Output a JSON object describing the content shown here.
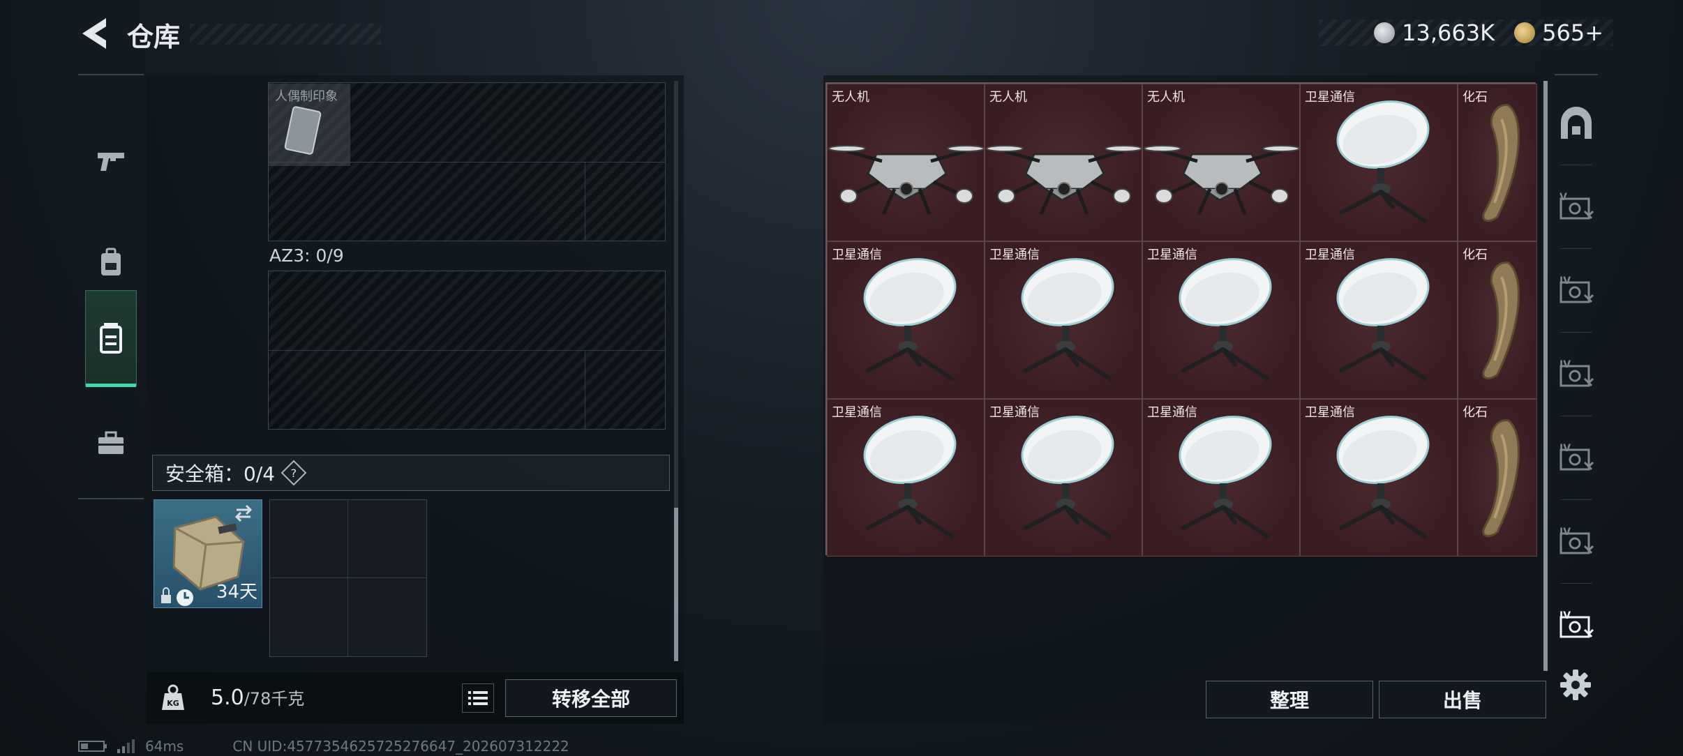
{
  "header": {
    "title": "仓库",
    "currency_silver": "13,663K",
    "currency_gold": "565+"
  },
  "left_nav": {
    "items": [
      "pistol-icon",
      "backpack-icon",
      "chest-rig-icon",
      "toolbox-icon"
    ],
    "active_index": 2
  },
  "left_panel": {
    "tagged_bag_label": "人偶制印象",
    "container_label": "AZ3: 0/9",
    "safe_box_label": "安全箱：0/4",
    "safe_help": "?",
    "safe_item_days": "34天",
    "weight_value": "5.0",
    "weight_max": "/78千克",
    "transfer_all": "转移全部"
  },
  "items": [
    {
      "label": "无人机",
      "icon": "drone-icon"
    },
    {
      "label": "无人机",
      "icon": "drone-icon"
    },
    {
      "label": "无人机",
      "icon": "drone-icon"
    },
    {
      "label": "卫星通信",
      "icon": "satellite-dish-icon"
    },
    {
      "label": "化石",
      "icon": "fossil-claw-icon"
    },
    {
      "label": "卫星通信",
      "icon": "satellite-dish-icon"
    },
    {
      "label": "卫星通信",
      "icon": "satellite-dish-icon"
    },
    {
      "label": "卫星通信",
      "icon": "satellite-dish-icon"
    },
    {
      "label": "卫星通信",
      "icon": "satellite-dish-icon"
    },
    {
      "label": "化石",
      "icon": "fossil-claw-icon"
    },
    {
      "label": "卫星通信",
      "icon": "satellite-dish-icon"
    },
    {
      "label": "卫星通信",
      "icon": "satellite-dish-icon"
    },
    {
      "label": "卫星通信",
      "icon": "satellite-dish-icon"
    },
    {
      "label": "卫星通信",
      "icon": "satellite-dish-icon"
    },
    {
      "label": "化石",
      "icon": "fossil-claw-icon"
    }
  ],
  "actions": {
    "sort": "整理",
    "sell": "出售"
  },
  "right_nav": {
    "items": [
      "home-safe-icon",
      "stash-V-icon",
      "stash-IV-icon",
      "stash-IV-icon",
      "stash-IV-icon",
      "stash-IV-icon",
      "stash-IV-active-icon"
    ]
  },
  "status": {
    "ping": "64ms",
    "uid": "CN UID:4577354625725276647_202607312222"
  },
  "colors": {
    "accent_green": "#3fd8a7",
    "item_bg_red": "#3b1f24"
  }
}
